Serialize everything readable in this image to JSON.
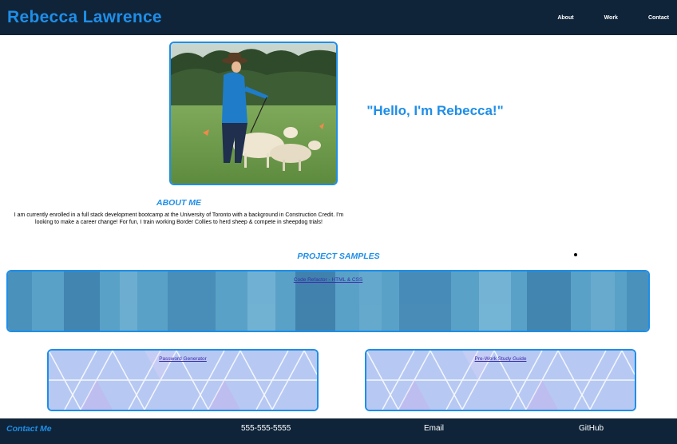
{
  "header": {
    "brand": "Rebecca Lawrence",
    "nav": [
      "About",
      "Work",
      "Contact"
    ]
  },
  "hero": {
    "greeting": "\"Hello, I'm Rebecca!\""
  },
  "about": {
    "title": "ABOUT ME",
    "text": "I am currently enrolled in a full stack development bootcamp at the University of Toronto with a background in Construction Credit. I'm looking to make a career change! For fun, I train working Border Collies to herd sheep & compete in sheepdog trials!"
  },
  "projects": {
    "title": "PROJECT SAMPLES",
    "items": [
      {
        "label": "Code Refactor - HTML & CSS"
      },
      {
        "label": "Password Generator"
      },
      {
        "label": "Pre-Work Study Guide"
      }
    ]
  },
  "footer": {
    "contact": "Contact Me",
    "phone": "555-555-5555",
    "email": "Email",
    "github": "GitHub"
  },
  "colors": {
    "accent": "#1e8ee8",
    "navy": "#0f2439",
    "link": "#3d2aa8"
  }
}
